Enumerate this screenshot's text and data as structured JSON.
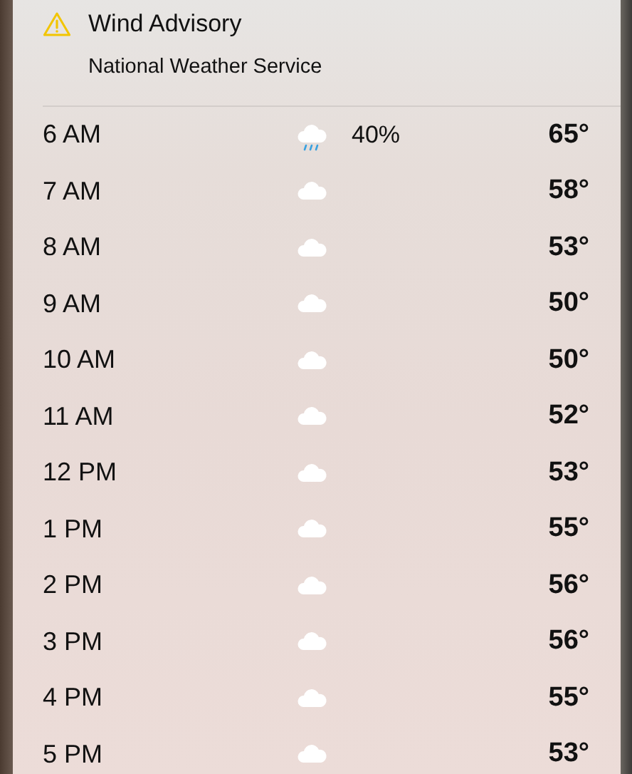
{
  "alert": {
    "title": "Wind Advisory",
    "source": "National Weather Service"
  },
  "hours": [
    {
      "time": "6 AM",
      "kind": "rain",
      "chance": "40%",
      "temp": "65°"
    },
    {
      "time": "7 AM",
      "kind": "cloud",
      "temp": "58°"
    },
    {
      "time": "8 AM",
      "kind": "cloud",
      "temp": "53°"
    },
    {
      "time": "9 AM",
      "kind": "cloud",
      "temp": "50°"
    },
    {
      "time": "10 AM",
      "kind": "cloud",
      "temp": "50°"
    },
    {
      "time": "11 AM",
      "kind": "cloud",
      "temp": "52°"
    },
    {
      "time": "12 PM",
      "kind": "cloud",
      "temp": "53°"
    },
    {
      "time": "1 PM",
      "kind": "cloud",
      "temp": "55°"
    },
    {
      "time": "2 PM",
      "kind": "cloud",
      "temp": "56°"
    },
    {
      "time": "3 PM",
      "kind": "cloud",
      "temp": "56°"
    },
    {
      "time": "4 PM",
      "kind": "cloud",
      "temp": "55°"
    },
    {
      "time": "5 PM",
      "kind": "cloud",
      "temp": "53°"
    }
  ]
}
